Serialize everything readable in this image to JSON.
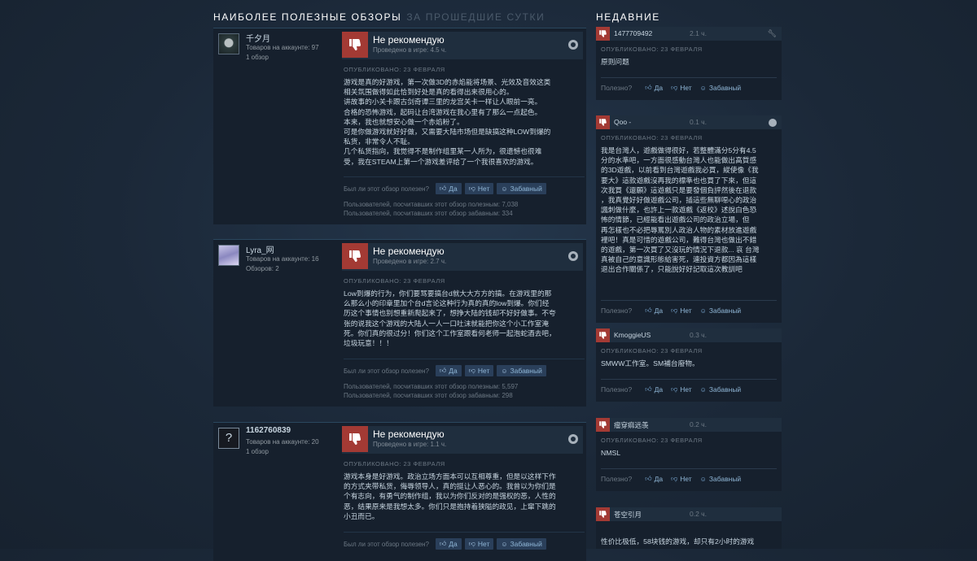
{
  "headings": {
    "main": "НАИБОЛЕЕ ПОЛЕЗНЫЕ ОБЗОРЫ",
    "period": "ЗА ПРОШЕДШИЕ СУТКИ",
    "recent": "НЕДАВНИЕ"
  },
  "reviews": [
    {
      "author": "千夕月",
      "meta1": "Товаров на аккаунте: 97",
      "meta2": "1 обзор",
      "verdict": "Не рекомендую",
      "hours": "Проведено в игре: 4.5 ч.",
      "date": "ОПУБЛИКОВАНО: 23 ФЕВРАЛЯ",
      "body": "游戏是真的好游戏，第一次做3D的赤焰能将场景、光效及音效这类\n相关氛围做得如此恰到好处是真的看得出来很用心的。\n讲故事的小关卡跟古剑奇谭三里的龙宫关卡一样让人眼前一亮。\n合格的恐怖游戏，起码让台湾游戏在我心里有了那么一点起色。\n本来，我也就想安心做一个赤焰粉了。\n可是你做游戏就好好做，又需要大陆市场但是缺搞这种LOW到爆的\n私货，非常令人不耻。\n几个私货指向，我觉得不是制作组里某一人所为，很遗憾也很难\n受，我在STEAM上第一个游戏差评给了一个我很喜欢的游戏。",
      "helpful_q": "Был ли этот обзор полезен?",
      "yes": "Да",
      "no": "Нет",
      "funny": "Забавный",
      "stats1": "Пользователей, посчитавших этот обзор полезным: 7,038",
      "stats2": "Пользователей, посчитавших этот обзор забавным: 334"
    },
    {
      "author": "Lyra_网",
      "meta1": "Товаров на аккаунте: 16",
      "meta2": "Обзоров: 2",
      "verdict": "Не рекомендую",
      "hours": "Проведено в игре: 2.7 ч.",
      "date": "ОПУБЛИКОВАНО: 23 ФЕВРАЛЯ",
      "body": "Low到爆的行为，你们要骂要搞台d就大大方方的搞。在游戏里的那\n么那么小的印章里加个台d言论这种行为真的真的low到爆。你们经\n历这个事情也别想重新爬起来了，想挣大陆的钱却不好好做事。不夸\n张的说我这个游戏的大陆人一人一口吐沫就能把你这个小工作室淹\n死。你们真的很过分！你们这个工作室跟看何老师一起泡蛇酒去吧，\n垃圾玩意！！！",
      "helpful_q": "Был ли этот обзор полезен?",
      "yes": "Да",
      "no": "Нет",
      "funny": "Забавный",
      "stats1": "Пользователей, посчитавших этот обзор полезным: 5,597",
      "stats2": "Пользователей, посчитавших этот обзор забавным: 298"
    },
    {
      "author": "1162760839",
      "meta1": "Товаров на аккаунте: 20",
      "meta2": "1 обзор",
      "avatar_glyph": "?",
      "verdict": "Не рекомендую",
      "hours": "Проведено в игре: 1.1 ч.",
      "date": "ОПУБЛИКОВАНО: 23 ФЕВРАЛЯ",
      "body": "游戏本身是好游戏。政治立场方面本可以互相尊重，但是以这样下作\n的方式夹带私货，侮辱领导人，真的挺让人恶心的。我曾以为你们是\n个有志向，有勇气的制作组，我以为你们反对的是强权的恶，人性的\n恶，结果原来是我想太多。你们只是抱持着狭隘的政见，上窜下跳的\n小丑而已。",
      "helpful_q": "Был ли этот обзор полезен?",
      "yes": "Да",
      "no": "Нет",
      "funny": "Забавный"
    }
  ],
  "recent": [
    {
      "name": "1477709492",
      "time": "2.1 ч.",
      "date": "ОПУБЛИКОВАНО: 23 ФЕВРАЛЯ",
      "body": "原则问题",
      "helpful_q": "Полезно?",
      "yes": "Да",
      "no": "Нет",
      "funny": "Забавный"
    },
    {
      "name": "Qoo -",
      "time": "0.1 ч.",
      "date": "ОПУБЛИКОВАНО: 23 ФЕВРАЛЯ",
      "body": "我是台灣人，遊戲做得很好，若整體滿分5分有4.5\n分的水準吧，一方面很感動台灣人也能做出高質感\n的3D遊戲，以前看到台灣遊戲我必買，縱使像《我\n要大》這款遊戲沒再我的標準也也買了下來，但這\n次我買《還願》這遊戲只是要發個負評然後在退款\n，我真覺好好做遊戲公司，插這些無聊噁心的政治\n諷刺做什麼，也許上一款遊戲《返校》述說白色恐\n怖的情節，已經能看出遊戲公司的政治立場，但\n再怎樣也不必把辱罵別人政治人物的素材放進遊戲\n裡吧！真是可惜的遊戲公司，難得台灣也做出不錯\n的遊戲，第一次買了又沒玩的情況下退款... 哀 台灣\n真被自己的意識形態給害死，連投資方都因為這樣\n退出合作關係了，只能說好好記取這次教訓吧",
      "helpful_q": "Полезно?",
      "yes": "Да",
      "no": "Нет",
      "funny": "Забавный"
    },
    {
      "name": "KmoggieUS",
      "time": "0.3 ч.",
      "date": "ОПУБЛИКОВАНО: 23 ФЕВРАЛЯ",
      "body": "SMWW工作室。SM補台廢物。",
      "helpful_q": "Полезно?",
      "yes": "Да",
      "no": "Нет",
      "funny": "Забавный"
    },
    {
      "name": "瘤穿痲远羡",
      "time": "0.2 ч.",
      "date": "ОПУБЛИКОВАНО: 23 ФЕВРАЛЯ",
      "body": "NMSL",
      "helpful_q": "Полезно?",
      "yes": "Да",
      "no": "Нет",
      "funny": "Забавный"
    },
    {
      "name": "苍空引月",
      "time": "0.2 ч.",
      "body": "性价比极低，58块钱的游戏，却只有2小时的游戏"
    }
  ]
}
